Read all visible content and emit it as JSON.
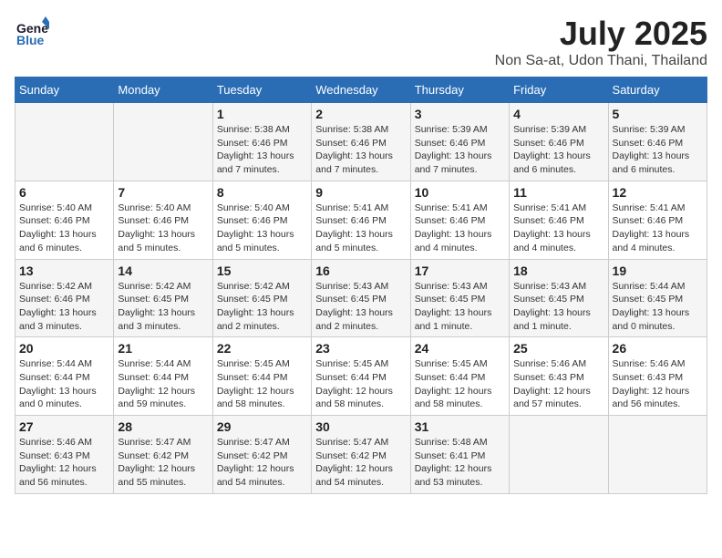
{
  "header": {
    "logo_general": "General",
    "logo_blue": "Blue",
    "month_year": "July 2025",
    "location": "Non Sa-at, Udon Thani, Thailand"
  },
  "weekdays": [
    "Sunday",
    "Monday",
    "Tuesday",
    "Wednesday",
    "Thursday",
    "Friday",
    "Saturday"
  ],
  "weeks": [
    [
      {
        "day": "",
        "detail": ""
      },
      {
        "day": "",
        "detail": ""
      },
      {
        "day": "1",
        "detail": "Sunrise: 5:38 AM\nSunset: 6:46 PM\nDaylight: 13 hours and 7 minutes."
      },
      {
        "day": "2",
        "detail": "Sunrise: 5:38 AM\nSunset: 6:46 PM\nDaylight: 13 hours and 7 minutes."
      },
      {
        "day": "3",
        "detail": "Sunrise: 5:39 AM\nSunset: 6:46 PM\nDaylight: 13 hours and 7 minutes."
      },
      {
        "day": "4",
        "detail": "Sunrise: 5:39 AM\nSunset: 6:46 PM\nDaylight: 13 hours and 6 minutes."
      },
      {
        "day": "5",
        "detail": "Sunrise: 5:39 AM\nSunset: 6:46 PM\nDaylight: 13 hours and 6 minutes."
      }
    ],
    [
      {
        "day": "6",
        "detail": "Sunrise: 5:40 AM\nSunset: 6:46 PM\nDaylight: 13 hours and 6 minutes."
      },
      {
        "day": "7",
        "detail": "Sunrise: 5:40 AM\nSunset: 6:46 PM\nDaylight: 13 hours and 5 minutes."
      },
      {
        "day": "8",
        "detail": "Sunrise: 5:40 AM\nSunset: 6:46 PM\nDaylight: 13 hours and 5 minutes."
      },
      {
        "day": "9",
        "detail": "Sunrise: 5:41 AM\nSunset: 6:46 PM\nDaylight: 13 hours and 5 minutes."
      },
      {
        "day": "10",
        "detail": "Sunrise: 5:41 AM\nSunset: 6:46 PM\nDaylight: 13 hours and 4 minutes."
      },
      {
        "day": "11",
        "detail": "Sunrise: 5:41 AM\nSunset: 6:46 PM\nDaylight: 13 hours and 4 minutes."
      },
      {
        "day": "12",
        "detail": "Sunrise: 5:41 AM\nSunset: 6:46 PM\nDaylight: 13 hours and 4 minutes."
      }
    ],
    [
      {
        "day": "13",
        "detail": "Sunrise: 5:42 AM\nSunset: 6:46 PM\nDaylight: 13 hours and 3 minutes."
      },
      {
        "day": "14",
        "detail": "Sunrise: 5:42 AM\nSunset: 6:45 PM\nDaylight: 13 hours and 3 minutes."
      },
      {
        "day": "15",
        "detail": "Sunrise: 5:42 AM\nSunset: 6:45 PM\nDaylight: 13 hours and 2 minutes."
      },
      {
        "day": "16",
        "detail": "Sunrise: 5:43 AM\nSunset: 6:45 PM\nDaylight: 13 hours and 2 minutes."
      },
      {
        "day": "17",
        "detail": "Sunrise: 5:43 AM\nSunset: 6:45 PM\nDaylight: 13 hours and 1 minute."
      },
      {
        "day": "18",
        "detail": "Sunrise: 5:43 AM\nSunset: 6:45 PM\nDaylight: 13 hours and 1 minute."
      },
      {
        "day": "19",
        "detail": "Sunrise: 5:44 AM\nSunset: 6:45 PM\nDaylight: 13 hours and 0 minutes."
      }
    ],
    [
      {
        "day": "20",
        "detail": "Sunrise: 5:44 AM\nSunset: 6:44 PM\nDaylight: 13 hours and 0 minutes."
      },
      {
        "day": "21",
        "detail": "Sunrise: 5:44 AM\nSunset: 6:44 PM\nDaylight: 12 hours and 59 minutes."
      },
      {
        "day": "22",
        "detail": "Sunrise: 5:45 AM\nSunset: 6:44 PM\nDaylight: 12 hours and 58 minutes."
      },
      {
        "day": "23",
        "detail": "Sunrise: 5:45 AM\nSunset: 6:44 PM\nDaylight: 12 hours and 58 minutes."
      },
      {
        "day": "24",
        "detail": "Sunrise: 5:45 AM\nSunset: 6:44 PM\nDaylight: 12 hours and 58 minutes."
      },
      {
        "day": "25",
        "detail": "Sunrise: 5:46 AM\nSunset: 6:43 PM\nDaylight: 12 hours and 57 minutes."
      },
      {
        "day": "26",
        "detail": "Sunrise: 5:46 AM\nSunset: 6:43 PM\nDaylight: 12 hours and 56 minutes."
      }
    ],
    [
      {
        "day": "27",
        "detail": "Sunrise: 5:46 AM\nSunset: 6:43 PM\nDaylight: 12 hours and 56 minutes."
      },
      {
        "day": "28",
        "detail": "Sunrise: 5:47 AM\nSunset: 6:42 PM\nDaylight: 12 hours and 55 minutes."
      },
      {
        "day": "29",
        "detail": "Sunrise: 5:47 AM\nSunset: 6:42 PM\nDaylight: 12 hours and 54 minutes."
      },
      {
        "day": "30",
        "detail": "Sunrise: 5:47 AM\nSunset: 6:42 PM\nDaylight: 12 hours and 54 minutes."
      },
      {
        "day": "31",
        "detail": "Sunrise: 5:48 AM\nSunset: 6:41 PM\nDaylight: 12 hours and 53 minutes."
      },
      {
        "day": "",
        "detail": ""
      },
      {
        "day": "",
        "detail": ""
      }
    ]
  ]
}
